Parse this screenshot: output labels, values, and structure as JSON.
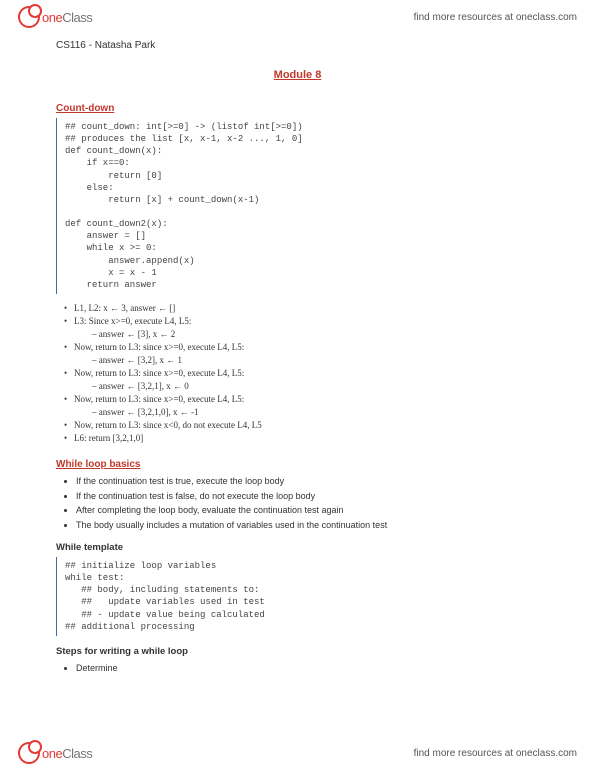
{
  "brand": {
    "one": "one",
    "class": "Class",
    "link": "find more resources at oneclass.com"
  },
  "course": "CS116 - Natasha Park",
  "module": "Module 8",
  "sec_countdown": "Count-down",
  "code1": [
    "## count_down: int[>=0] -> (listof int[>=0])",
    "## produces the list [x, x-1, x-2 ..., 1, 0]",
    "def count_down(x):",
    "    if x==0:",
    "        return [0]",
    "    else:",
    "        return [x] + count_down(x-1)",
    "",
    "def count_down2(x):",
    "    answer = []",
    "    while x >= 0:",
    "        answer.append(x)",
    "        x = x - 1",
    "    return answer"
  ],
  "trace": [
    {
      "b": "•",
      "t": "L1, L2: x ← 3,  answer ← []"
    },
    {
      "b": "•",
      "t": "L3: Since x>=0, execute L4, L5:"
    },
    {
      "b": "",
      "t": "– answer ← [3], x ← 2",
      "sub": true
    },
    {
      "b": "•",
      "t": "Now, return to L3:  since x>=0, execute L4, L5:"
    },
    {
      "b": "",
      "t": "– answer ← [3,2], x ← 1",
      "sub": true
    },
    {
      "b": "•",
      "t": "Now, return to L3:  since x>=0, execute L4, L5:"
    },
    {
      "b": "",
      "t": "– answer ← [3,2,1], x ← 0",
      "sub": true
    },
    {
      "b": "•",
      "t": "Now, return to L3:  since x>=0, execute L4, L5:"
    },
    {
      "b": "",
      "t": "– answer ← [3,2,1,0], x ← -1",
      "sub": true
    },
    {
      "b": "•",
      "t": "Now, return to L3:  since x<0, do not execute L4, L5"
    },
    {
      "b": "•",
      "t": "L6: return [3,2,1,0]"
    }
  ],
  "sec_while": "While loop basics",
  "while_bullets": [
    "If the continuation test is true, execute the loop body",
    "If the continuation test is false, do not execute the loop body",
    "After completing the loop body, evaluate the continuation test again",
    "The body usually includes a mutation of variables used in the continuation test"
  ],
  "sub_template": "While template",
  "code2": [
    "## initialize loop variables",
    "while test:",
    "   ## body, including statements to:",
    "   ##   update variables used in test",
    "   ## - update value being calculated",
    "## additional processing"
  ],
  "sub_steps": "Steps for writing a while loop",
  "steps_bullets": [
    "Determine"
  ]
}
